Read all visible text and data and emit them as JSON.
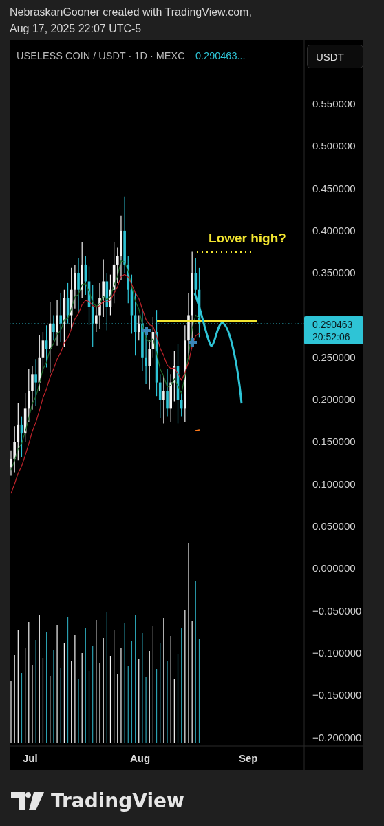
{
  "credit": {
    "line_1": "NebraskanGooner created with TradingView.com,",
    "line_2": "Aug 17, 2025 22:07 UTC-5"
  },
  "legend": {
    "symbol": "USELESS COIN / USDT · 1D · MEXC",
    "price": "0.290463..."
  },
  "currency_button": "USDT",
  "price_axis": [
    "0.550000",
    "0.500000",
    "0.450000",
    "0.400000",
    "0.350000",
    "0.250000",
    "0.200000",
    "0.150000",
    "0.100000",
    "0.050000",
    "0.000000",
    "−0.050000",
    "−0.100000",
    "−0.150000",
    "−0.200000"
  ],
  "current_price": {
    "price": "0.290463",
    "countdown": "20:52:06"
  },
  "annotation": "Lower high?",
  "time_axis": [
    "Jul",
    "Aug",
    "Sep"
  ],
  "logo": "TradingView"
}
